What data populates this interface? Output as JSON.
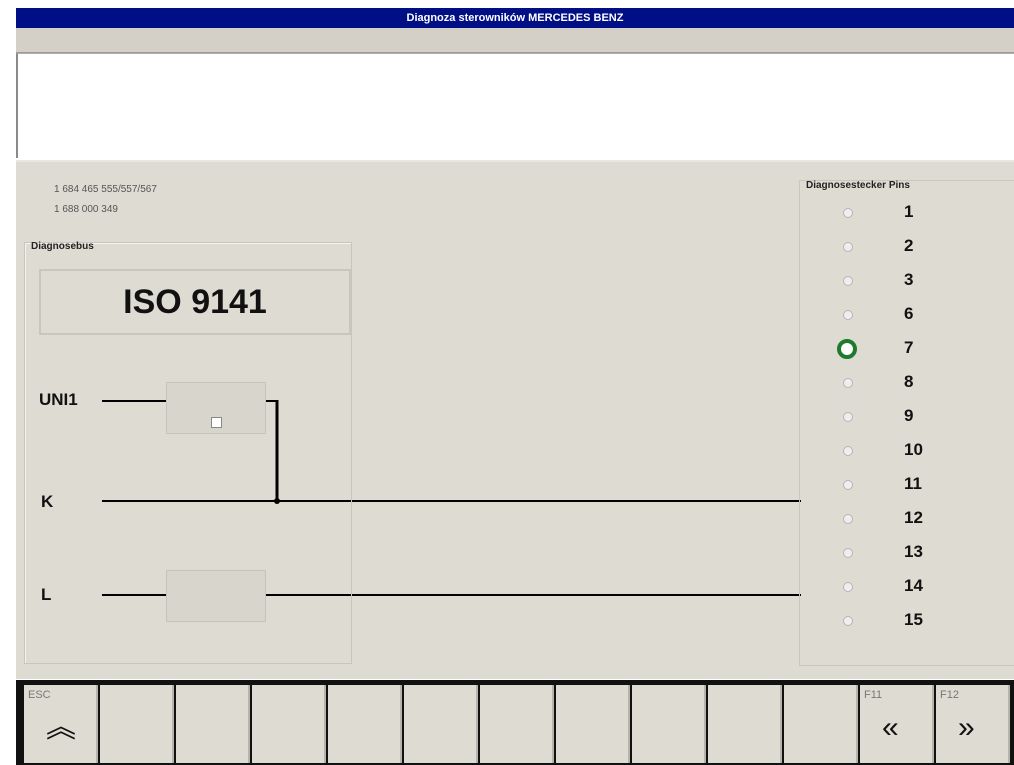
{
  "window": {
    "title": "Diagnoza sterowników MERCEDES BENZ"
  },
  "part_numbers": [
    "1 684 465 555/557/567",
    "1 688 000 349"
  ],
  "diagnosebus": {
    "group_label": "Diagnosebus",
    "protocol": "ISO 9141",
    "lines": [
      "UNI1",
      "K",
      "L"
    ]
  },
  "pins": {
    "group_label": "Diagnosestecker Pins",
    "items": [
      "1",
      "2",
      "3",
      "6",
      "7",
      "8",
      "9",
      "10",
      "11",
      "12",
      "13",
      "14",
      "15"
    ],
    "selected": "7"
  },
  "fkeys": [
    {
      "code": "ESC",
      "icon": "double-chevron-up-icon",
      "glyph": "︽"
    },
    {
      "code": "",
      "icon": "",
      "glyph": ""
    },
    {
      "code": "",
      "icon": "",
      "glyph": ""
    },
    {
      "code": "",
      "icon": "",
      "glyph": ""
    },
    {
      "code": "",
      "icon": "",
      "glyph": ""
    },
    {
      "code": "",
      "icon": "",
      "glyph": ""
    },
    {
      "code": "",
      "icon": "",
      "glyph": ""
    },
    {
      "code": "",
      "icon": "",
      "glyph": ""
    },
    {
      "code": "",
      "icon": "",
      "glyph": ""
    },
    {
      "code": "",
      "icon": "",
      "glyph": ""
    },
    {
      "code": "",
      "icon": "",
      "glyph": ""
    },
    {
      "code": "F11",
      "icon": "double-chevron-left-icon",
      "glyph": "«"
    },
    {
      "code": "F12",
      "icon": "double-chevron-right-icon",
      "glyph": "»"
    }
  ],
  "colors": {
    "titlebar": "#000f86",
    "panel": "#dedbd2",
    "selected_radio": "#1f7a2d"
  }
}
